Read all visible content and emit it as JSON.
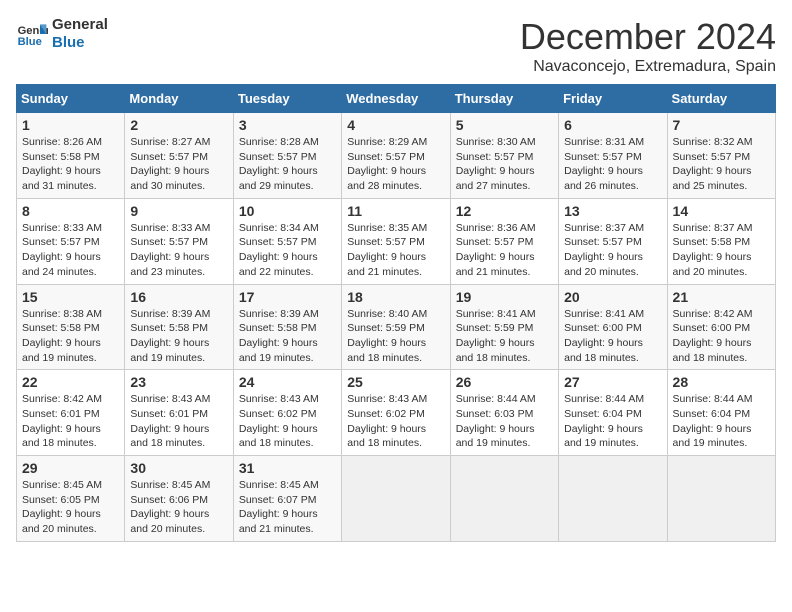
{
  "logo": {
    "line1": "General",
    "line2": "Blue"
  },
  "title": "December 2024",
  "location": "Navaconcejo, Extremadura, Spain",
  "days_of_week": [
    "Sunday",
    "Monday",
    "Tuesday",
    "Wednesday",
    "Thursday",
    "Friday",
    "Saturday"
  ],
  "weeks": [
    [
      {
        "day": "1",
        "sunrise": "8:26 AM",
        "sunset": "5:58 PM",
        "daylight": "9 hours and 31 minutes."
      },
      {
        "day": "2",
        "sunrise": "8:27 AM",
        "sunset": "5:57 PM",
        "daylight": "9 hours and 30 minutes."
      },
      {
        "day": "3",
        "sunrise": "8:28 AM",
        "sunset": "5:57 PM",
        "daylight": "9 hours and 29 minutes."
      },
      {
        "day": "4",
        "sunrise": "8:29 AM",
        "sunset": "5:57 PM",
        "daylight": "9 hours and 28 minutes."
      },
      {
        "day": "5",
        "sunrise": "8:30 AM",
        "sunset": "5:57 PM",
        "daylight": "9 hours and 27 minutes."
      },
      {
        "day": "6",
        "sunrise": "8:31 AM",
        "sunset": "5:57 PM",
        "daylight": "9 hours and 26 minutes."
      },
      {
        "day": "7",
        "sunrise": "8:32 AM",
        "sunset": "5:57 PM",
        "daylight": "9 hours and 25 minutes."
      }
    ],
    [
      {
        "day": "8",
        "sunrise": "8:33 AM",
        "sunset": "5:57 PM",
        "daylight": "9 hours and 24 minutes."
      },
      {
        "day": "9",
        "sunrise": "8:33 AM",
        "sunset": "5:57 PM",
        "daylight": "9 hours and 23 minutes."
      },
      {
        "day": "10",
        "sunrise": "8:34 AM",
        "sunset": "5:57 PM",
        "daylight": "9 hours and 22 minutes."
      },
      {
        "day": "11",
        "sunrise": "8:35 AM",
        "sunset": "5:57 PM",
        "daylight": "9 hours and 21 minutes."
      },
      {
        "day": "12",
        "sunrise": "8:36 AM",
        "sunset": "5:57 PM",
        "daylight": "9 hours and 21 minutes."
      },
      {
        "day": "13",
        "sunrise": "8:37 AM",
        "sunset": "5:57 PM",
        "daylight": "9 hours and 20 minutes."
      },
      {
        "day": "14",
        "sunrise": "8:37 AM",
        "sunset": "5:58 PM",
        "daylight": "9 hours and 20 minutes."
      }
    ],
    [
      {
        "day": "15",
        "sunrise": "8:38 AM",
        "sunset": "5:58 PM",
        "daylight": "9 hours and 19 minutes."
      },
      {
        "day": "16",
        "sunrise": "8:39 AM",
        "sunset": "5:58 PM",
        "daylight": "9 hours and 19 minutes."
      },
      {
        "day": "17",
        "sunrise": "8:39 AM",
        "sunset": "5:58 PM",
        "daylight": "9 hours and 19 minutes."
      },
      {
        "day": "18",
        "sunrise": "8:40 AM",
        "sunset": "5:59 PM",
        "daylight": "9 hours and 18 minutes."
      },
      {
        "day": "19",
        "sunrise": "8:41 AM",
        "sunset": "5:59 PM",
        "daylight": "9 hours and 18 minutes."
      },
      {
        "day": "20",
        "sunrise": "8:41 AM",
        "sunset": "6:00 PM",
        "daylight": "9 hours and 18 minutes."
      },
      {
        "day": "21",
        "sunrise": "8:42 AM",
        "sunset": "6:00 PM",
        "daylight": "9 hours and 18 minutes."
      }
    ],
    [
      {
        "day": "22",
        "sunrise": "8:42 AM",
        "sunset": "6:01 PM",
        "daylight": "9 hours and 18 minutes."
      },
      {
        "day": "23",
        "sunrise": "8:43 AM",
        "sunset": "6:01 PM",
        "daylight": "9 hours and 18 minutes."
      },
      {
        "day": "24",
        "sunrise": "8:43 AM",
        "sunset": "6:02 PM",
        "daylight": "9 hours and 18 minutes."
      },
      {
        "day": "25",
        "sunrise": "8:43 AM",
        "sunset": "6:02 PM",
        "daylight": "9 hours and 18 minutes."
      },
      {
        "day": "26",
        "sunrise": "8:44 AM",
        "sunset": "6:03 PM",
        "daylight": "9 hours and 19 minutes."
      },
      {
        "day": "27",
        "sunrise": "8:44 AM",
        "sunset": "6:04 PM",
        "daylight": "9 hours and 19 minutes."
      },
      {
        "day": "28",
        "sunrise": "8:44 AM",
        "sunset": "6:04 PM",
        "daylight": "9 hours and 19 minutes."
      }
    ],
    [
      {
        "day": "29",
        "sunrise": "8:45 AM",
        "sunset": "6:05 PM",
        "daylight": "9 hours and 20 minutes."
      },
      {
        "day": "30",
        "sunrise": "8:45 AM",
        "sunset": "6:06 PM",
        "daylight": "9 hours and 20 minutes."
      },
      {
        "day": "31",
        "sunrise": "8:45 AM",
        "sunset": "6:07 PM",
        "daylight": "9 hours and 21 minutes."
      },
      null,
      null,
      null,
      null
    ]
  ],
  "labels": {
    "sunrise": "Sunrise:",
    "sunset": "Sunset:",
    "daylight": "Daylight:"
  }
}
